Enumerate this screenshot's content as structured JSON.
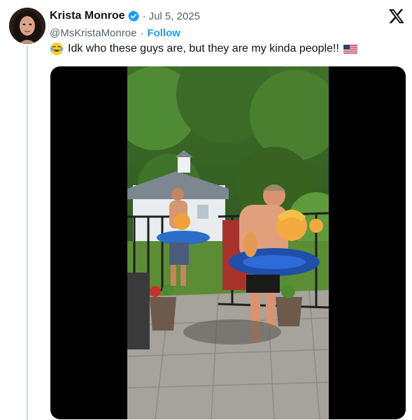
{
  "tweet": {
    "author_name": "Krista Monroe",
    "separator": "·",
    "date": "Jul 5, 2025",
    "handle": "@MsKristaMonroe",
    "handle_separator": "·",
    "follow_label": "Follow",
    "text": "Idk who these guys are, but they are my kinda people!!",
    "leading_emoji": "laughing-crying-emoji",
    "trailing_emoji": "us-flag-emoji"
  },
  "colors": {
    "accent": "#1d9bf0",
    "text_primary": "#0f1419",
    "text_secondary": "#536471",
    "media_background": "#000000"
  },
  "icons": [
    "verified-badge-icon",
    "x-logo-icon"
  ]
}
